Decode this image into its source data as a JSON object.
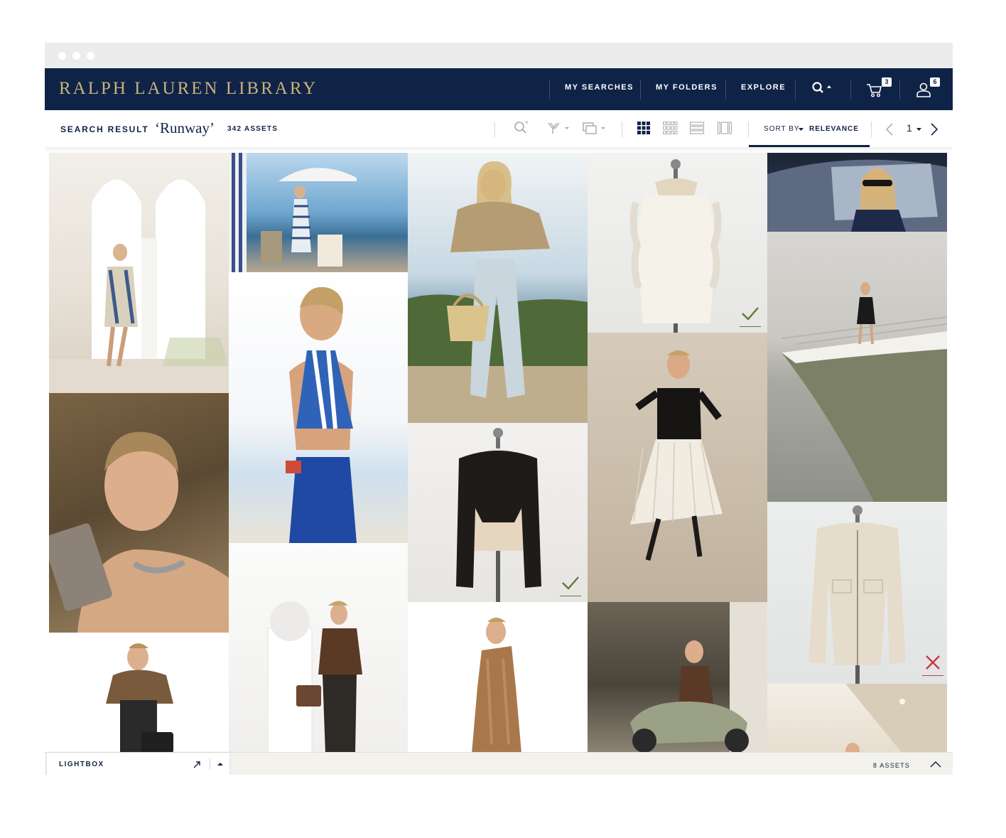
{
  "window": {
    "controls": [
      "close",
      "minimize",
      "maximize"
    ]
  },
  "header": {
    "brand": "RALPH LAUREN LIBRARY",
    "nav": [
      {
        "label": "MY SEARCHES"
      },
      {
        "label": "MY FOLDERS"
      },
      {
        "label": "EXPLORE"
      }
    ],
    "icons": {
      "search": "search-icon",
      "cart": "cart-icon",
      "account": "account-icon"
    },
    "cart_count": "3",
    "account_count": "6"
  },
  "toolbar": {
    "label": "SEARCH RESULT",
    "query": "‘Runway’",
    "asset_count": "342 ASSETS",
    "sort_label": "SORT BY",
    "sort_value": "RELEVANCE",
    "page": "1",
    "view_modes": [
      "grid-large",
      "grid-small",
      "list",
      "single"
    ],
    "active_view": "grid-large"
  },
  "results": [
    {
      "id": "arches-woman",
      "marker": "none"
    },
    {
      "id": "beach-cabana",
      "marker": "none"
    },
    {
      "id": "knit-sweater-bag",
      "marker": "none"
    },
    {
      "id": "ruffle-blouse",
      "marker": "check"
    },
    {
      "id": "car-sunglasses",
      "marker": "none"
    },
    {
      "id": "yacht-bow",
      "marker": "none"
    },
    {
      "id": "scarf-halter-back",
      "marker": "none"
    },
    {
      "id": "clutch-portrait",
      "marker": "none"
    },
    {
      "id": "black-jacket-dress-form",
      "marker": "check"
    },
    {
      "id": "pleated-skirt",
      "marker": "none"
    },
    {
      "id": "cream-jacket-dress-form",
      "marker": "reject"
    },
    {
      "id": "fur-stole",
      "marker": "none"
    },
    {
      "id": "leather-jacket",
      "marker": "none"
    },
    {
      "id": "satin-gown",
      "marker": "none"
    },
    {
      "id": "vespa-scooter",
      "marker": "none"
    },
    {
      "id": "ceiling-light",
      "marker": "none"
    }
  ],
  "colors": {
    "navy": "#0f2347",
    "gold": "#c9b27c",
    "check": "#5c7a36",
    "reject": "#c53a3f"
  },
  "lightbox": {
    "title": "LIGHTBOX",
    "asset_count": "8 ASSETS"
  }
}
